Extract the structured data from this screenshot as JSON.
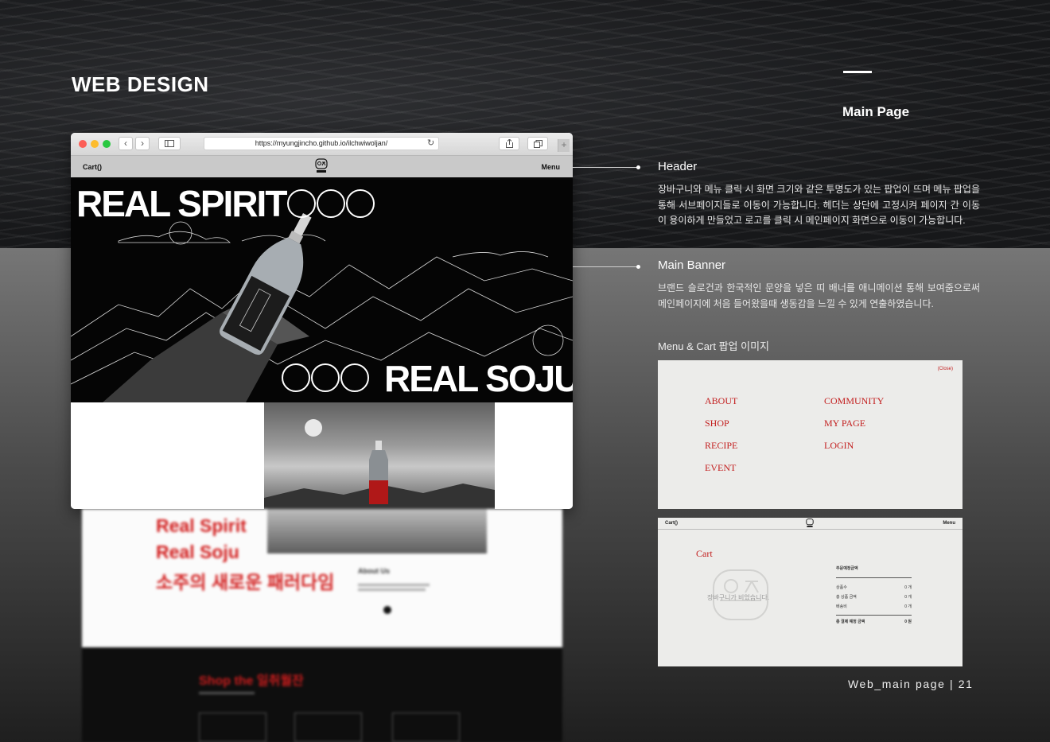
{
  "heading": "WEB DESIGN",
  "section_title": "Main Page",
  "browser": {
    "url": "https://myungjincho.github.io/ilchwiwoljan/",
    "site": {
      "cart_label": "Cart()",
      "menu_label": "Menu",
      "logo_text": "일취월잔"
    },
    "banner": {
      "title_top": "REAL SPIRIT",
      "title_bottom": "REAL SOJU"
    }
  },
  "blurred": {
    "line1": "Real Spirit",
    "line2": "Real Soju",
    "line3": "소주의 새로운 패러다임",
    "about_title": "About Us",
    "shop_title": "Shop the 일취월잔"
  },
  "annotations": [
    {
      "title": "Header",
      "text": "장바구니와 메뉴 클릭 시 화면 크기와 같은 투명도가 있는 팝업이 뜨며 메뉴 팝업을 통해 서브페이지들로 이동이 가능합니다. 헤더는 상단에 고정시켜 페이지 간 이동이 용이하게 만들었고 로고를 클릭 시 메인페이지 화면으로 이동이 가능합니다."
    },
    {
      "title": "Main Banner",
      "text": "브랜드 슬로건과 한국적인 문양을 넣은 띠 배너를 애니메이션 통해 보여줌으로써 메인페이지에 처음 들어왔을때 생동감을 느낄 수 있게 연출하였습니다."
    }
  ],
  "popup_caption": "Menu & Cart 팝업 이미지",
  "menu_popup": {
    "close_label": "(Close)",
    "items_left": [
      "ABOUT",
      "SHOP",
      "RECIPE",
      "EVENT"
    ],
    "items_right": [
      "COMMUNITY",
      "MY PAGE",
      "LOGIN"
    ]
  },
  "cart_popup": {
    "header_left": "Cart()",
    "header_right": "Menu",
    "title": "Cart",
    "empty_text": "장바구니가 비었습니다.",
    "summary_title": "주문예정금액",
    "rows": [
      {
        "label": "상품수",
        "value": "0 개"
      },
      {
        "label": "총 상품 금액",
        "value": "0 개"
      },
      {
        "label": "배송비",
        "value": "0 개"
      }
    ],
    "total_label": "총 결제 예정 금액",
    "total_value": "0 원"
  },
  "footer": "Web_main page  |  21",
  "colors": {
    "accent_red": "#c32020",
    "banner_bg": "#050505"
  }
}
